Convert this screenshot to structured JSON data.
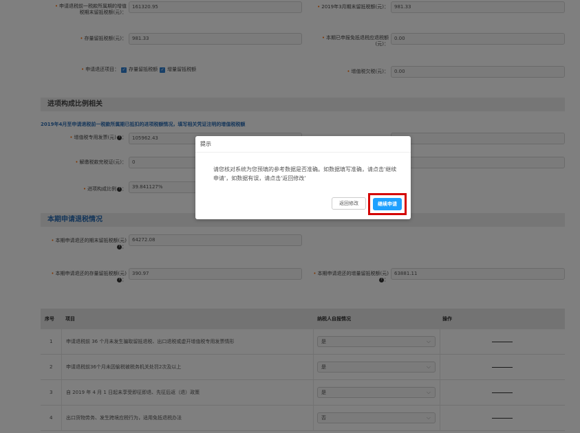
{
  "form": {
    "row1_left_label": "申请退税前一税款所属期的增值税期末留抵税额(元)：",
    "row1_left_label_a": "申请退税前一税款所属期的增值",
    "row1_left_label_b": "税期末留抵税额(元)：",
    "row1_left_value": "161320.95",
    "row1_right_label": "2019年3月期末留抵税额(元)：",
    "row1_right_value": "981.33",
    "row2_left_label": "存量留抵税额(元)：",
    "row2_left_value": "981.33",
    "row2_right_label_a": "本期已申报免抵退税应退税额",
    "row2_right_label_b": "(元)：",
    "row2_right_value": "0.00",
    "row3_left_label": "申请退还项目：",
    "row3_opt1": "存量留抵税额",
    "row3_opt2": "增量留抵税额",
    "row3_right_label": "增值税欠税(元)：",
    "row3_right_value": "0.00"
  },
  "section1": {
    "title": "进项构成比例相关",
    "note": "2019年4月至申请退税前一税款所属期已抵扣的进项税额情况，填写相关凭证注明的增值税税额",
    "r1_label": "增值税专用发票(元)",
    "r1_value": "105962.43",
    "r2_label": "解缴税款完税证(元)：",
    "r2_value": "0",
    "r2_right_partial": "2.43",
    "r3_label": "进项构成比例",
    "r3_value": "39.841127%"
  },
  "section2": {
    "title": "本期申请退税情况",
    "r1_label": "本期申请退还的期末留抵税额(元)",
    "r1_value": "64272.08",
    "r2_left_label": "本期申请退还的存量留抵税额(元)",
    "r2_left_value": "390.97",
    "r2_right_label": "本期申请退还的增量留抵税额(元)",
    "r2_right_value": "63881.11"
  },
  "table": {
    "headers": [
      "序号",
      "项目",
      "纳税人自报情况",
      "操作"
    ],
    "rows": [
      {
        "no": "1",
        "item": "申请退税前 36 个月未发生骗取留抵退税、出口退税或虚开增值税专用发票情形",
        "answer": "是"
      },
      {
        "no": "2",
        "item": "申请退税前36个月未因偷税被税务机关处罚2次及以上",
        "answer": "是"
      },
      {
        "no": "3",
        "item": "自 2019 年 4 月 1 日起未享受即征即退、先征后返（退）政策",
        "answer": "是"
      },
      {
        "no": "4",
        "item": "出口货物劳务、发生跨境应税行为，适用免抵退税办法",
        "answer": "否"
      }
    ]
  },
  "dialog": {
    "title": "提示",
    "message": "请您核对系统为您预填的参考数据是否准确。如数据填写准确，请点击'继续申请'，如数据有误，请点击'返回修改'",
    "back_label": "返回修改",
    "continue_label": "继续申请"
  },
  "colors": {
    "accent_blue": "#1ea0ff",
    "section_blue": "#2b6db5",
    "required_orange": "#ff6a00",
    "highlight_red": "#d40000"
  }
}
